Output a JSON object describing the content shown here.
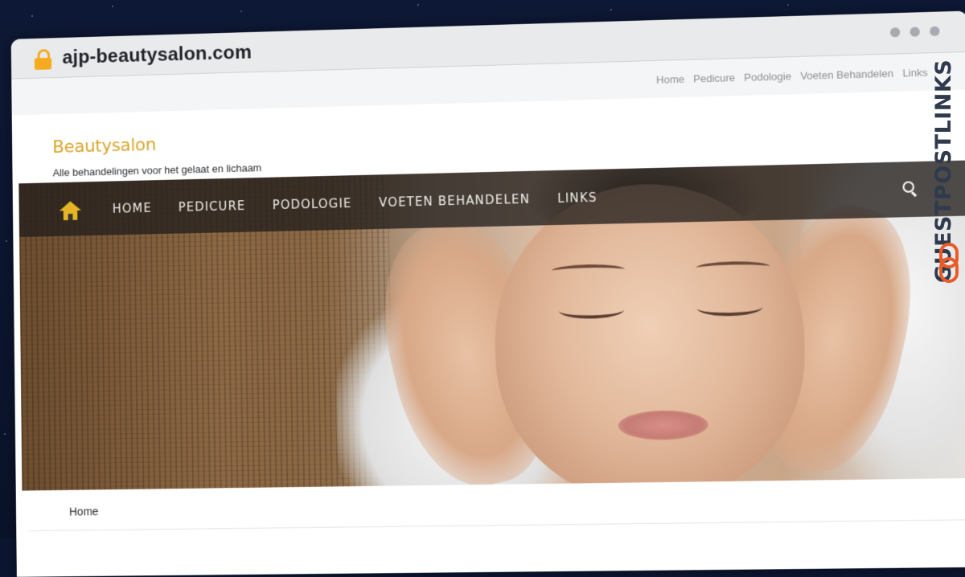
{
  "browser": {
    "url": "ajp-beautysalon.com"
  },
  "page": {
    "top_links": [
      "Home",
      "Pedicure",
      "Podologie",
      "Voeten Behandelen",
      "Links"
    ],
    "site_title": "Beautysalon",
    "site_tagline": "Alle behandelingen voor het gelaat en lichaam",
    "main_menu": [
      "HOME",
      "PEDICURE",
      "PODOLOGIE",
      "VOETEN BEHANDELEN",
      "LINKS"
    ],
    "breadcrumb": "Home"
  },
  "badge": {
    "text_part1": "GUEST",
    "text_part2": "POSTLINKS"
  },
  "colors": {
    "accent_gold": "#d8a62c",
    "home_icon": "#e4b524",
    "lock": "#f6ab1f",
    "badge_orange": "#ea5b2a",
    "badge_dark": "#2f3a4c"
  }
}
